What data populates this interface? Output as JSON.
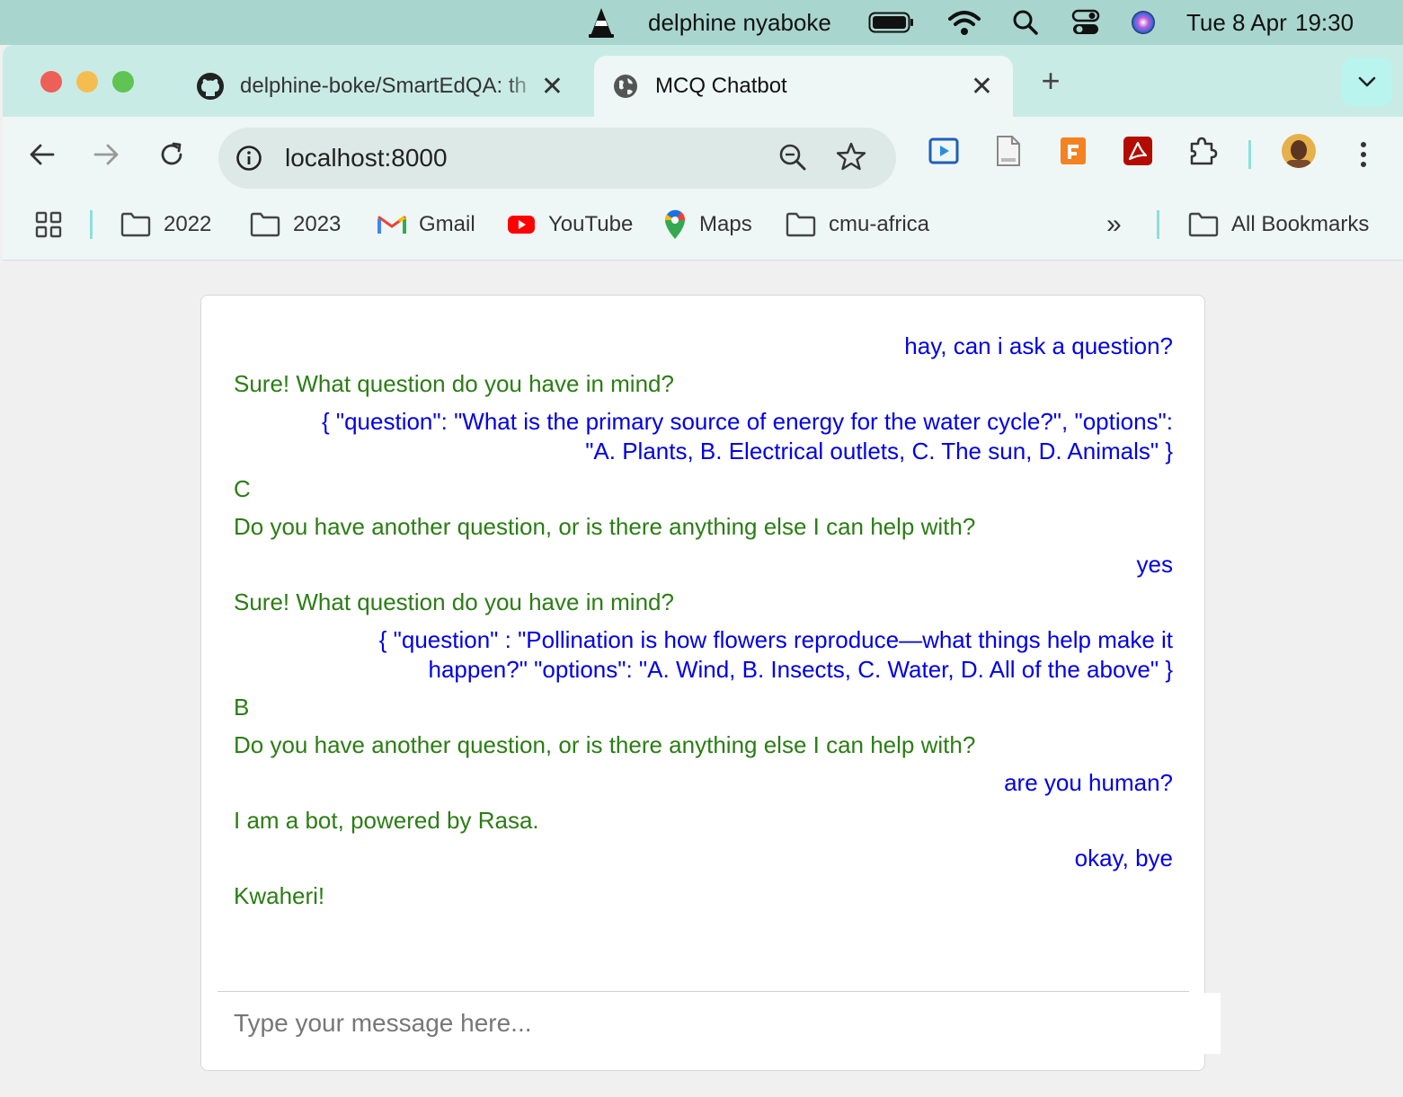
{
  "menubar": {
    "user": "delphine nyaboke",
    "date": "Tue 8 Apr",
    "time": "19:30",
    "icons": [
      "vlc-icon",
      "battery-icon",
      "wifi-icon",
      "spotlight-search-icon",
      "control-center-icon",
      "siri-icon"
    ]
  },
  "tabs": [
    {
      "title": "delphine-boke/SmartEdQA: th",
      "favicon": "github-icon",
      "active": false
    },
    {
      "title": "MCQ Chatbot",
      "favicon": "globe-icon",
      "active": true
    }
  ],
  "toolbar": {
    "url": "localhost:8000",
    "icons": [
      "back-icon",
      "forward-icon",
      "reload-icon",
      "site-info-icon",
      "zoom-icon",
      "bookmark-star-icon",
      "extension-icon",
      "profile-avatar",
      "more-menu-icon"
    ]
  },
  "bookmarks": {
    "items": [
      {
        "label": "2022",
        "icon": "folder-icon"
      },
      {
        "label": "2023",
        "icon": "folder-icon"
      },
      {
        "label": "Gmail",
        "icon": "gmail-icon"
      },
      {
        "label": "YouTube",
        "icon": "youtube-icon"
      },
      {
        "label": "Maps",
        "icon": "maps-icon"
      },
      {
        "label": "cmu-africa",
        "icon": "folder-icon"
      }
    ],
    "overflow": "»",
    "all_bookmarks": "All Bookmarks"
  },
  "chat": {
    "colors": {
      "user": "#0000e6",
      "bot": "#2b7d14"
    },
    "messages": [
      {
        "sender": "user",
        "text": "hay, can i ask a question?"
      },
      {
        "sender": "bot",
        "text": "Sure! What question do you have in mind?"
      },
      {
        "sender": "user",
        "text": "{ \"question\": \"What is the primary source of energy for the water cycle?\", \"options\": \"A. Plants, B. Electrical outlets, C. The sun, D. Animals\" }"
      },
      {
        "sender": "bot",
        "text": "C"
      },
      {
        "sender": "bot",
        "text": "Do you have another question, or is there anything else I can help with?"
      },
      {
        "sender": "user",
        "text": "yes"
      },
      {
        "sender": "bot",
        "text": "Sure! What question do you have in mind?"
      },
      {
        "sender": "user",
        "text": "{ \"question\" : \"Pollination is how flowers reproduce—what things help make it happen?\" \"options\": \"A. Wind, B. Insects, C. Water, D. All of the above\" }"
      },
      {
        "sender": "bot",
        "text": "B"
      },
      {
        "sender": "bot",
        "text": "Do you have another question, or is there anything else I can help with?"
      },
      {
        "sender": "user",
        "text": "are you human?"
      },
      {
        "sender": "bot",
        "text": "I am a bot, powered by Rasa."
      },
      {
        "sender": "user",
        "text": "okay, bye"
      },
      {
        "sender": "bot",
        "text": "Kwaheri!"
      }
    ],
    "input_placeholder": "Type your message here..."
  }
}
